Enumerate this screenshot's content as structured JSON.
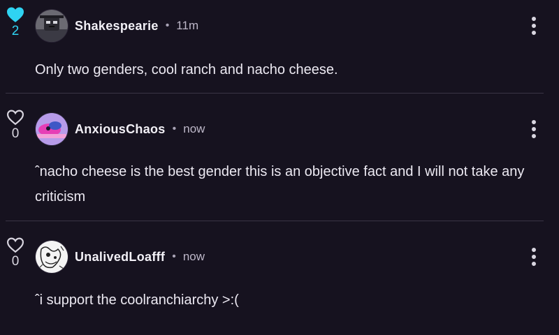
{
  "comments": [
    {
      "username": "Shakespearie",
      "time": "11m",
      "text": "Only two genders, cool ranch and nacho cheese.",
      "likes": "2",
      "liked": true
    },
    {
      "username": "AnxiousChaos",
      "time": "now",
      "text": "ˆnacho cheese is the best gender this is an objective fact and I will not take any criticism",
      "likes": "0",
      "liked": false
    },
    {
      "username": "UnalivedLoafff",
      "time": "now",
      "text": "ˆi support the coolranchiarchy >:(",
      "likes": "0",
      "liked": false
    }
  ],
  "separator": "•",
  "icons": {
    "like": "heart-icon",
    "more": "more-vertical-icon"
  },
  "colors": {
    "background": "#16121f",
    "liked": "#2fd3f2",
    "divider": "#3a3545"
  }
}
